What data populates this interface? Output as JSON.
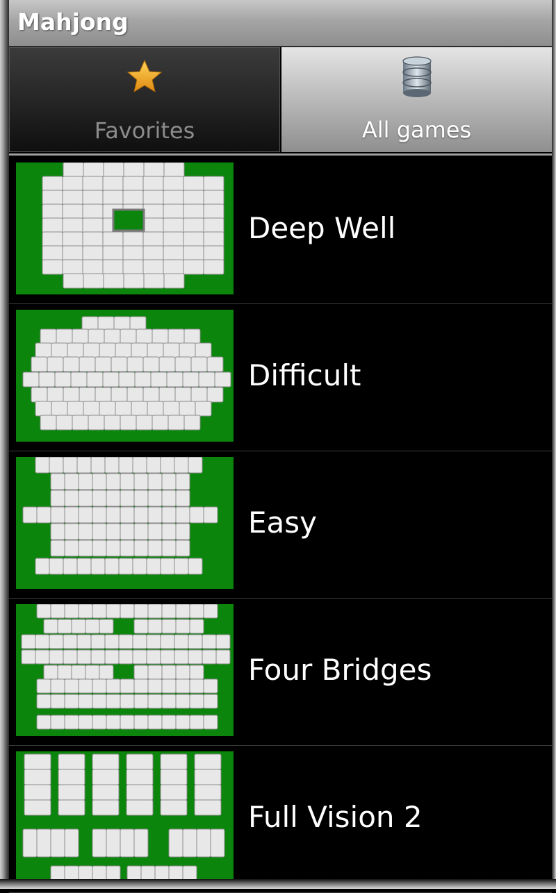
{
  "app": {
    "title": "Mahjong"
  },
  "tabs": [
    {
      "label": "Favorites",
      "icon": "star-icon",
      "selected": false
    },
    {
      "label": "All games",
      "icon": "database-icon",
      "selected": true
    }
  ],
  "games": [
    {
      "name": "Deep Well",
      "thumbnail": "deep-well-layout-icon"
    },
    {
      "name": "Difficult",
      "thumbnail": "difficult-layout-icon"
    },
    {
      "name": "Easy",
      "thumbnail": "easy-layout-icon"
    },
    {
      "name": "Four Bridges",
      "thumbnail": "four-bridges-layout-icon"
    },
    {
      "name": "Full Vision 2",
      "thumbnail": "full-vision-2-layout-icon"
    }
  ],
  "colors": {
    "board_green": "#0b850b",
    "tile_face": "#e8e8e8",
    "tile_edge": "#8c8c8c",
    "star": "#f5a623"
  }
}
